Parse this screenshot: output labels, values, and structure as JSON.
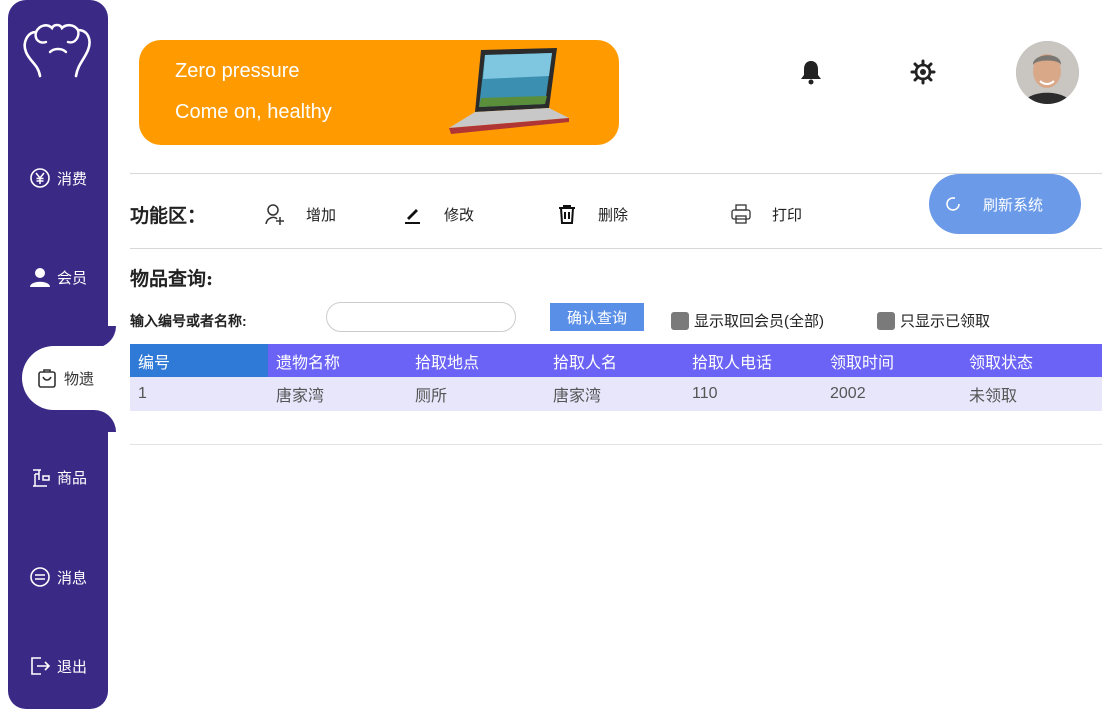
{
  "sidebar": {
    "items": [
      {
        "label": "消费",
        "icon": "yen-circle-icon"
      },
      {
        "label": "会员",
        "icon": "user-icon"
      },
      {
        "label": "物遗",
        "icon": "bag-icon"
      },
      {
        "label": "商品",
        "icon": "scale-icon"
      },
      {
        "label": "消息",
        "icon": "message-icon"
      },
      {
        "label": "退出",
        "icon": "logout-icon"
      }
    ],
    "active": "物遗"
  },
  "banner": {
    "line1": "Zero pressure",
    "line2": "Come on, healthy",
    "color": "#ff9b00"
  },
  "header": {
    "icons": [
      "bell-icon",
      "gear-icon"
    ]
  },
  "toolbar": {
    "title": "功能区：",
    "add_label": "增加",
    "edit_label": "修改",
    "delete_label": "删除",
    "print_label": "打印",
    "refresh_label": "刷新系统"
  },
  "query": {
    "title": "物品查询:",
    "label": "输入编号或者名称:",
    "input_value": "",
    "confirm_label": "确认查询",
    "check1_label": "显示取回会员(全部)",
    "check2_label": "只显示已领取"
  },
  "table": {
    "columns": [
      "编号",
      "遗物名称",
      "拾取地点",
      "拾取人名",
      "拾取人电话",
      "领取时间",
      "领取状态"
    ],
    "rows": [
      [
        "1",
        "唐家湾",
        "厕所",
        "唐家湾",
        "110",
        "2002",
        "未领取"
      ]
    ]
  },
  "colors": {
    "sidebar": "#3a2a86",
    "header_row": "#6b63f5",
    "first_header_cell": "#2f7ad6",
    "row_bg": "#e8e6fb",
    "refresh_button": "#6a9ae8",
    "confirm_button": "#5a8fe8"
  }
}
